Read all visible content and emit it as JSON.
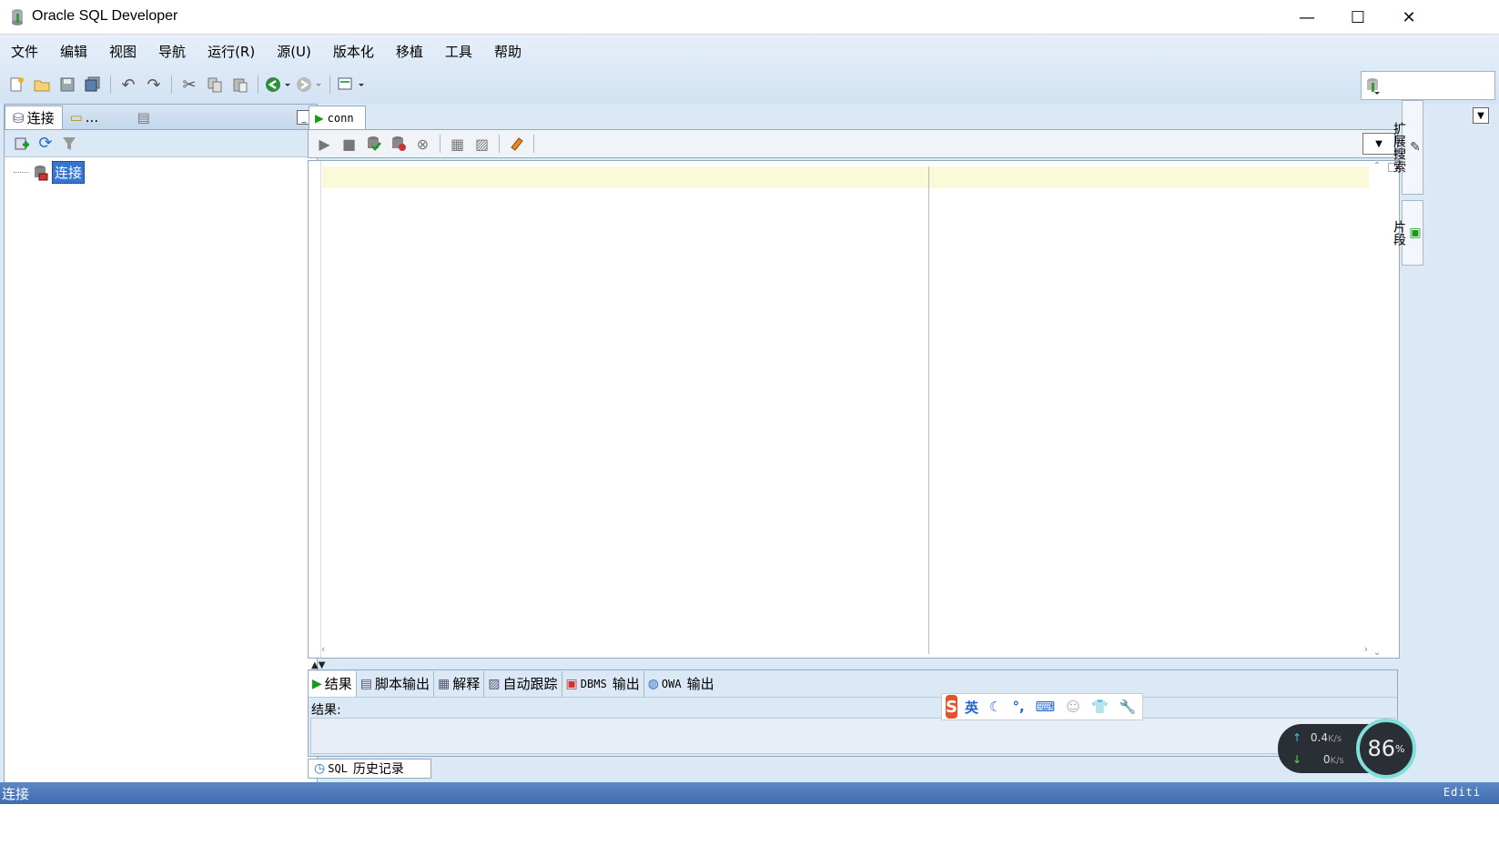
{
  "window": {
    "title": "Oracle SQL Developer",
    "minimize": "—",
    "maximize": "☐",
    "close": "✕"
  },
  "menu": [
    "文件",
    "编辑",
    "视图",
    "导航",
    "运行(R)",
    "源(U)",
    "版本化",
    "移植",
    "工具",
    "帮助"
  ],
  "left_panel": {
    "tabs": [
      "连接",
      "...",
      ""
    ],
    "tree_root": "连接"
  },
  "editor": {
    "tab_label": "conn"
  },
  "results": {
    "tabs": [
      "结果",
      "脚本输出",
      "解释",
      "自动跟踪",
      "DBMS",
      "输出",
      "OWA",
      "输出"
    ],
    "label": "结果:"
  },
  "history_tab": {
    "sql": "SQL",
    "label": "历史记录"
  },
  "right_dock": [
    "扩展搜索",
    "片段"
  ],
  "status": {
    "left": "连接",
    "right": "Editi"
  },
  "ime": {
    "logo": "S",
    "lang": "英"
  },
  "net": {
    "up": "0.4",
    "up_unit": "K/s",
    "down": "0",
    "down_unit": "K/s",
    "percent": "86",
    "pct_sign": "%"
  }
}
